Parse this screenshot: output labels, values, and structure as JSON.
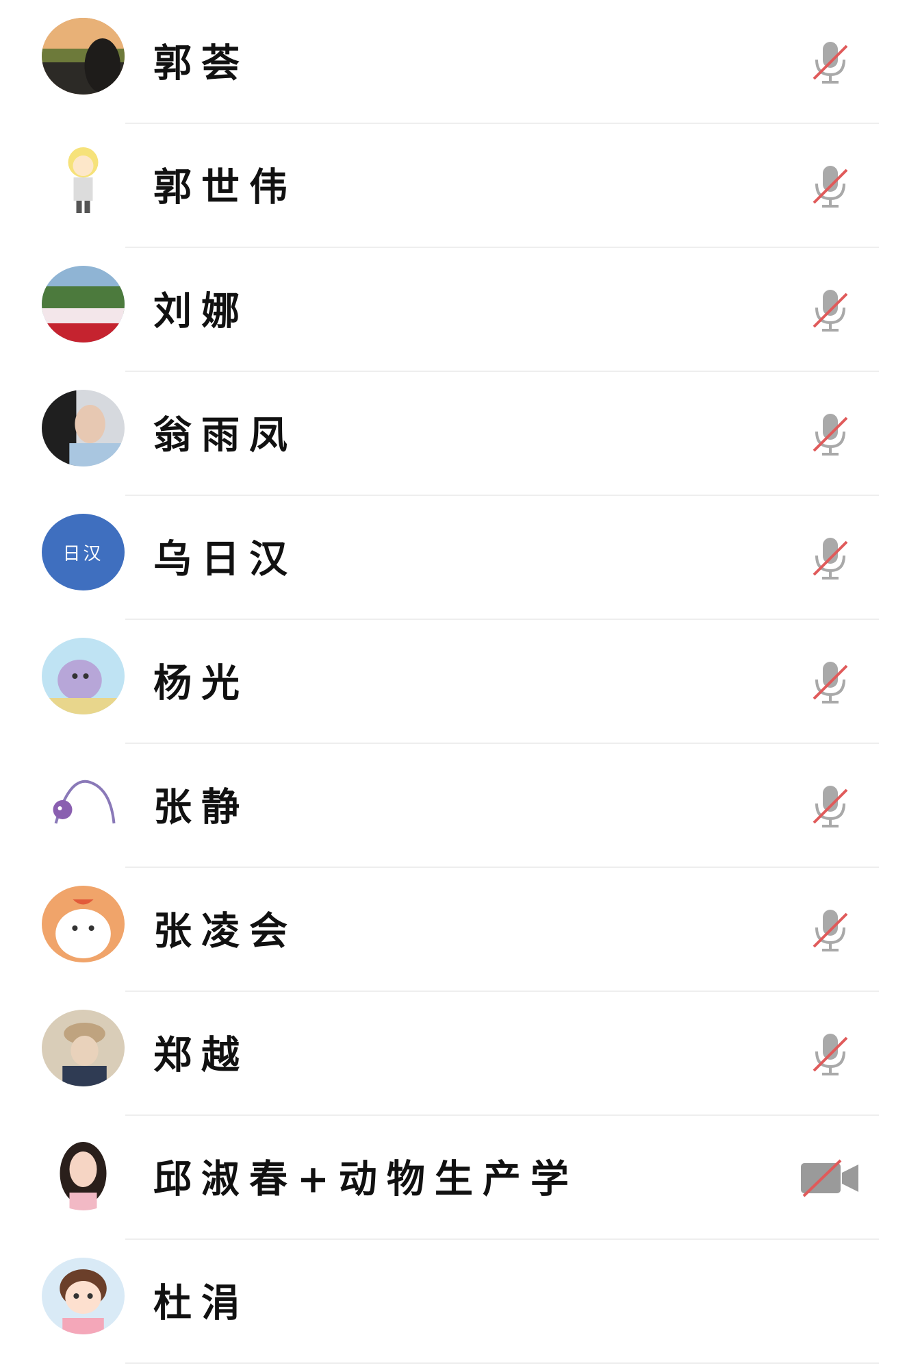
{
  "colors": {
    "divider": "#eeeeee",
    "muted_icon": "#9a9a9a",
    "strike": "#e05a5a",
    "initials_avatar_bg": "#3f6fbf"
  },
  "participants": [
    {
      "name": "郭荟",
      "avatar": "photo-sunset",
      "status_icon": "mic-muted-icon"
    },
    {
      "name": "郭世伟",
      "avatar": "cartoon-boy",
      "status_icon": "mic-muted-icon"
    },
    {
      "name": "刘娜",
      "avatar": "photo-park",
      "status_icon": "mic-muted-icon"
    },
    {
      "name": "翁雨凤",
      "avatar": "photo-person",
      "status_icon": "mic-muted-icon"
    },
    {
      "name": "乌日汉",
      "avatar": "initials",
      "initials": "日汉",
      "status_icon": "mic-muted-icon"
    },
    {
      "name": "杨光",
      "avatar": "cartoon-bird",
      "status_icon": "mic-muted-icon"
    },
    {
      "name": "张静",
      "avatar": "sketch",
      "status_icon": "mic-muted-icon"
    },
    {
      "name": "张凌会",
      "avatar": "cartoon-dog",
      "status_icon": "mic-muted-icon"
    },
    {
      "name": "郑越",
      "avatar": "photo-hat",
      "status_icon": "mic-muted-icon"
    },
    {
      "name": "邱淑春+动物生产学",
      "avatar": "illustrated-girl",
      "status_icon": "video-off-icon"
    },
    {
      "name": "杜涓",
      "avatar": "cartoon-girl",
      "status_icon": ""
    }
  ]
}
